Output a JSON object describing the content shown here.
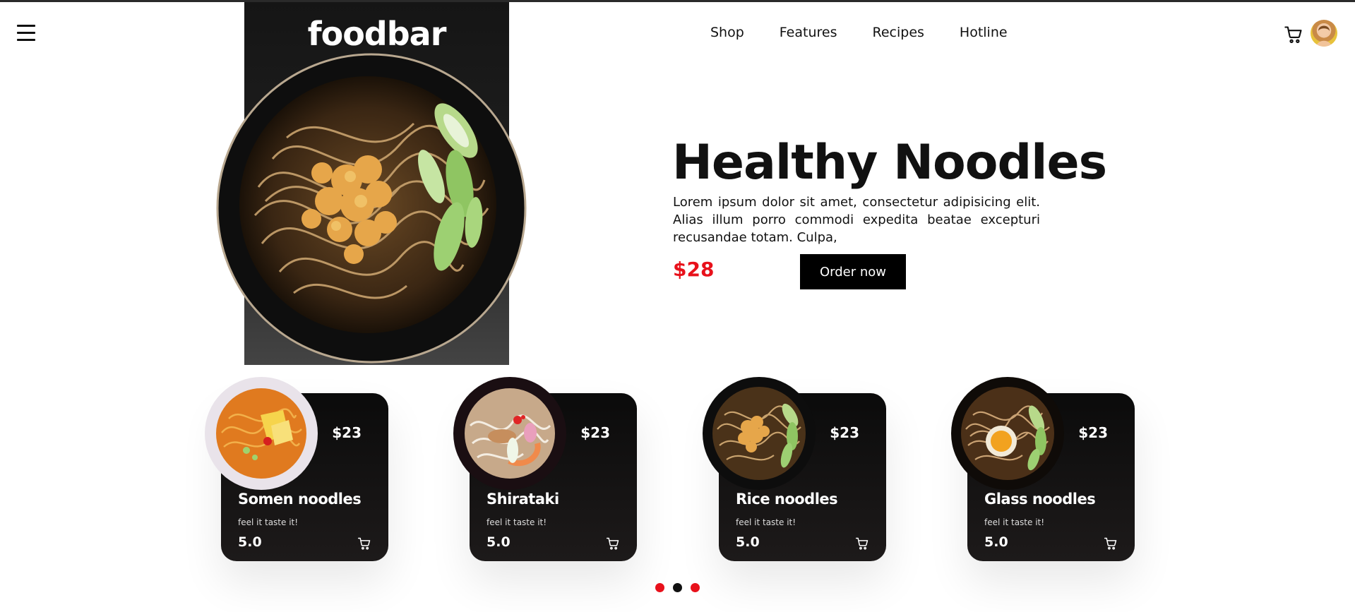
{
  "header": {
    "brand": "foodbar",
    "nav": [
      "Shop",
      "Features",
      "Recipes",
      "Hotline"
    ],
    "menu_icon": "hamburger-icon",
    "cart_icon": "cart-icon"
  },
  "hero": {
    "title": "Healthy Noodles",
    "description": "Lorem ipsum dolor sit amet, consectetur adipisicing elit. Alias illum porro commodi expedita beatae excepturi recusandae totam. Culpa,",
    "price": "$28",
    "cta": "Order now"
  },
  "cards": [
    {
      "name": "Somen noodles",
      "price": "$23",
      "tagline": "feel it taste it!",
      "rating": "5.0",
      "bowl": "white"
    },
    {
      "name": "Shirataki",
      "price": "$23",
      "tagline": "feel it taste it!",
      "rating": "5.0",
      "bowl": "dark"
    },
    {
      "name": "Rice noodles",
      "price": "$23",
      "tagline": "feel it taste it!",
      "rating": "5.0",
      "bowl": "dark"
    },
    {
      "name": "Glass noodles",
      "price": "$23",
      "tagline": "feel it taste it!",
      "rating": "5.0",
      "bowl": "dark"
    }
  ],
  "pagination": {
    "count": 3,
    "active": 1
  },
  "colors": {
    "accent": "#e8111b",
    "dark": "#000000",
    "dot_active": "#111111",
    "dot_inactive": "#e8111b"
  }
}
